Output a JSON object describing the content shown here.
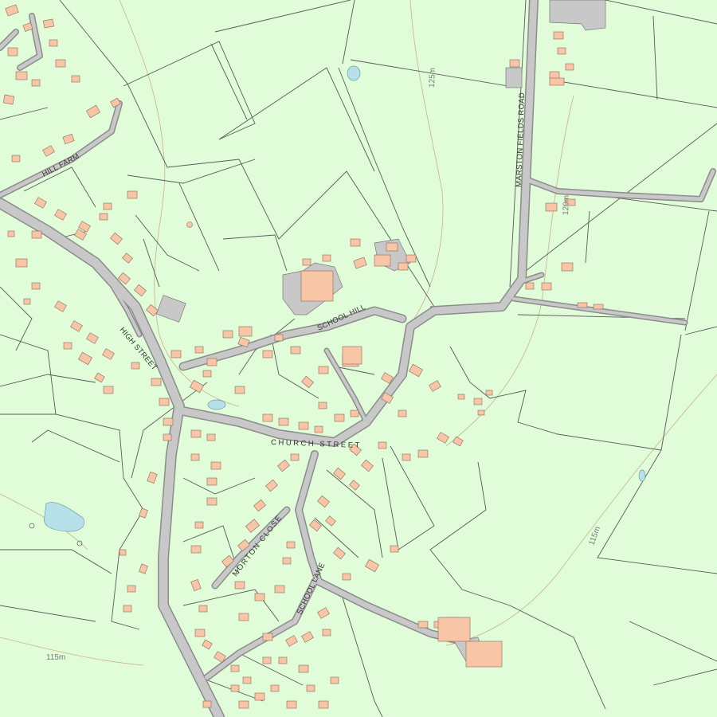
{
  "map": {
    "background_color": "#e0fcd8",
    "road_color": "#c8c8c8",
    "building_color": "#f8c6a6",
    "water_color": "#b6e1e8",
    "contour_color": "#c9b28a"
  },
  "labels": {
    "hill_farm": "HILL FARM",
    "high_street": "HIGH STREET",
    "school_hill": "SCHOOL HILL",
    "church_street": "CHURCH STREET",
    "marston_fields_road": "MARSTON FIELDS ROAD",
    "morton_close": "MORTON CLOSE",
    "school_lane": "SCHOOL LANE"
  },
  "contours": {
    "c125": "125m",
    "c120": "120m",
    "c115_east": "115m",
    "c115_west": "115m"
  }
}
